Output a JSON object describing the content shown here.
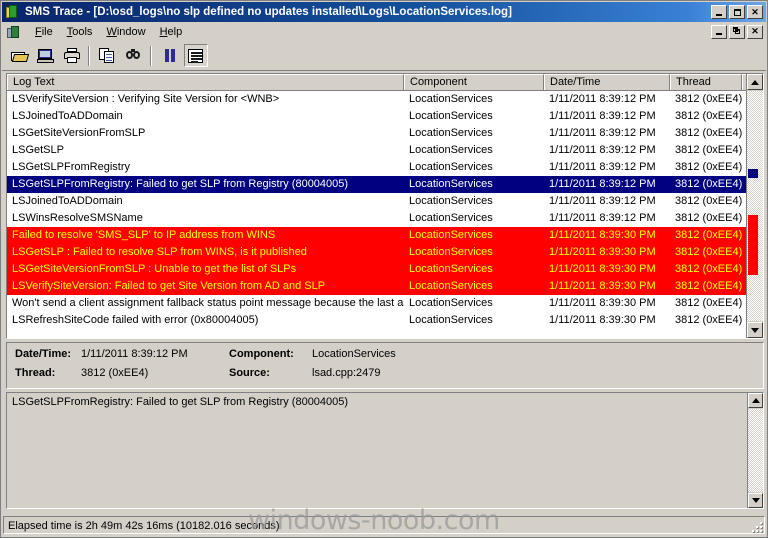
{
  "window": {
    "title": "SMS Trace - [D:\\osd_logs\\no slp  defined no updates installed\\Logs\\LocationServices.log]",
    "icon": "sms-trace-icon",
    "buttons": {
      "minimize": "minimize-button",
      "maximize": "maximize-button",
      "close": "close-button"
    },
    "mdi_buttons": {
      "minimize": "mdi-minimize-button",
      "restore": "mdi-restore-button",
      "close": "mdi-close-button"
    }
  },
  "menu": {
    "icon": "document-icon",
    "items": [
      {
        "label": "File",
        "accel": "F"
      },
      {
        "label": "Tools",
        "accel": "T"
      },
      {
        "label": "Window",
        "accel": "W"
      },
      {
        "label": "Help",
        "accel": "H"
      }
    ]
  },
  "toolbar": {
    "items": [
      {
        "name": "open-file-button",
        "icon": "open-folder-icon"
      },
      {
        "name": "save-button",
        "icon": "save-disk-icon"
      },
      {
        "name": "print-button",
        "icon": "printer-icon"
      },
      {
        "name": "copy-button",
        "icon": "copy-pages-icon"
      },
      {
        "name": "find-button",
        "icon": "binoculars-icon"
      },
      {
        "name": "pause-button",
        "icon": "pause-icon"
      },
      {
        "name": "flat-view-button",
        "icon": "lines-document-icon"
      }
    ]
  },
  "log_list": {
    "columns": [
      "Log Text",
      "Component",
      "Date/Time",
      "Thread"
    ],
    "rows": [
      {
        "text": "LSVerifySiteVersion : Verifying Site Version for <WNB>",
        "component": "LocationServices",
        "datetime": "1/11/2011 8:39:12 PM",
        "thread": "3812 (0xEE4)",
        "state": "normal"
      },
      {
        "text": "LSJoinedToADDomain",
        "component": "LocationServices",
        "datetime": "1/11/2011 8:39:12 PM",
        "thread": "3812 (0xEE4)",
        "state": "normal"
      },
      {
        "text": "LSGetSiteVersionFromSLP",
        "component": "LocationServices",
        "datetime": "1/11/2011 8:39:12 PM",
        "thread": "3812 (0xEE4)",
        "state": "normal"
      },
      {
        "text": "LSGetSLP",
        "component": "LocationServices",
        "datetime": "1/11/2011 8:39:12 PM",
        "thread": "3812 (0xEE4)",
        "state": "normal"
      },
      {
        "text": "LSGetSLPFromRegistry",
        "component": "LocationServices",
        "datetime": "1/11/2011 8:39:12 PM",
        "thread": "3812 (0xEE4)",
        "state": "normal"
      },
      {
        "text": "LSGetSLPFromRegistry: Failed to get SLP from Registry (80004005)",
        "component": "LocationServices",
        "datetime": "1/11/2011 8:39:12 PM",
        "thread": "3812 (0xEE4)",
        "state": "selected"
      },
      {
        "text": "LSJoinedToADDomain",
        "component": "LocationServices",
        "datetime": "1/11/2011 8:39:12 PM",
        "thread": "3812 (0xEE4)",
        "state": "normal"
      },
      {
        "text": "LSWinsResolveSMSName",
        "component": "LocationServices",
        "datetime": "1/11/2011 8:39:12 PM",
        "thread": "3812 (0xEE4)",
        "state": "normal"
      },
      {
        "text": "Failed to resolve 'SMS_SLP' to IP address from WINS",
        "component": "LocationServices",
        "datetime": "1/11/2011 8:39:30 PM",
        "thread": "3812 (0xEE4)",
        "state": "error"
      },
      {
        "text": "LSGetSLP : Failed to resolve SLP from WINS, is it published",
        "component": "LocationServices",
        "datetime": "1/11/2011 8:39:30 PM",
        "thread": "3812 (0xEE4)",
        "state": "error"
      },
      {
        "text": "LSGetSiteVersionFromSLP : Unable to get the list of SLPs",
        "component": "LocationServices",
        "datetime": "1/11/2011 8:39:30 PM",
        "thread": "3812 (0xEE4)",
        "state": "error"
      },
      {
        "text": "LSVerifySiteVersion: Failed to get Site Version from AD and SLP",
        "component": "LocationServices",
        "datetime": "1/11/2011 8:39:30 PM",
        "thread": "3812 (0xEE4)",
        "state": "error"
      },
      {
        "text": "Won't send a client assignment fallback status point message because the last assignment was successful",
        "component": "LocationServices",
        "datetime": "1/11/2011 8:39:30 PM",
        "thread": "3812 (0xEE4)",
        "state": "normal"
      },
      {
        "text": "LSRefreshSiteCode failed with error (0x80004005)",
        "component": "LocationServices",
        "datetime": "1/11/2011 8:39:30 PM",
        "thread": "3812 (0xEE4)",
        "state": "normal"
      }
    ]
  },
  "detail": {
    "datetime_label": "Date/Time:",
    "datetime_value": "1/11/2011 8:39:12 PM",
    "component_label": "Component:",
    "component_value": "LocationServices",
    "thread_label": "Thread:",
    "thread_value": "3812 (0xEE4)",
    "source_label": "Source:",
    "source_value": "lsad.cpp:2479"
  },
  "memo": {
    "text": "LSGetSLPFromRegistry: Failed to get SLP from Registry (80004005)"
  },
  "status": {
    "text": "Elapsed time is 2h 49m 42s 16ms (10182.016 seconds)"
  },
  "watermark": {
    "text": "windows-noob.com"
  },
  "colors": {
    "title_start": "#0a246a",
    "title_end": "#6ca6e8",
    "face": "#d4d0c8",
    "selected_bg": "#000080",
    "error_bg": "#ff0000",
    "error_fg": "#ffff00"
  }
}
